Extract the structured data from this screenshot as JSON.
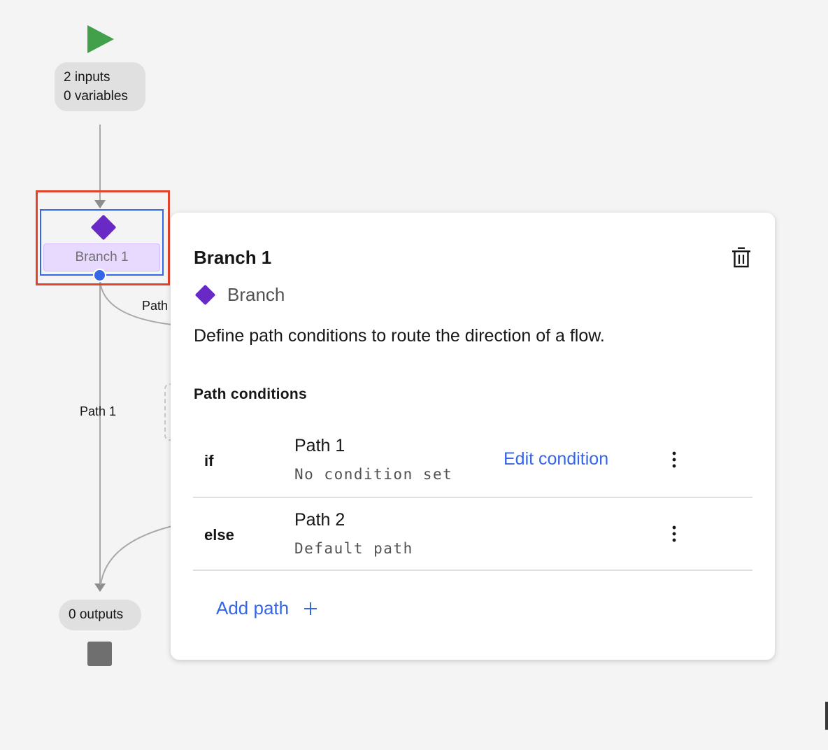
{
  "canvas": {
    "start": {
      "icon": "play-icon",
      "inputs_label": "2 inputs",
      "variables_label": "0 variables"
    },
    "branch_node": {
      "icon": "branch-diamond-icon",
      "label": "Branch 1"
    },
    "edges": {
      "path1_label": "Path 1",
      "path2_label": "Path"
    },
    "end": {
      "outputs_label": "0 outputs",
      "icon": "stop-icon"
    }
  },
  "panel": {
    "title": "Branch 1",
    "delete_icon": "trash-icon",
    "type_icon": "branch-diamond-icon",
    "type_label": "Branch",
    "description": "Define path conditions to route the direction of a flow.",
    "section_title": "Path conditions",
    "conditions": [
      {
        "keyword": "if",
        "name": "Path 1",
        "subtitle": "No condition set",
        "action": "Edit condition",
        "menu_icon": "overflow-menu-icon"
      },
      {
        "keyword": "else",
        "name": "Path 2",
        "subtitle": "Default path",
        "menu_icon": "overflow-menu-icon"
      }
    ],
    "add_path_label": "Add path",
    "add_icon": "plus-icon"
  },
  "colors": {
    "start_green": "#42a04b",
    "branch_purple": "#6929c4",
    "link_blue": "#3466e8",
    "selection_red": "#e0452b",
    "canvas_bg": "#f4f4f4"
  }
}
